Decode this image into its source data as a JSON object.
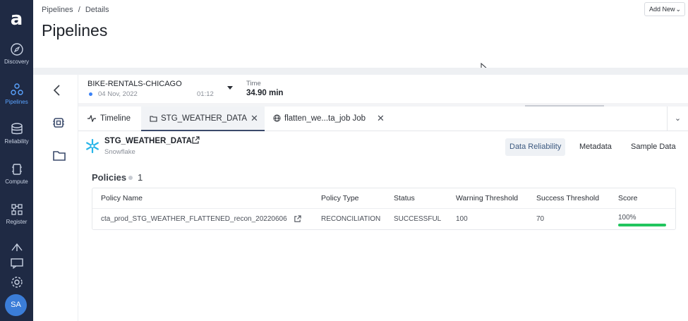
{
  "sidebar": {
    "logo": "a",
    "items": [
      {
        "label": "Discovery",
        "icon": "compass-icon",
        "active": false
      },
      {
        "label": "Pipelines",
        "icon": "pipelines-icon",
        "active": true
      },
      {
        "label": "Reliability",
        "icon": "database-icon",
        "active": false
      },
      {
        "label": "Compute",
        "icon": "chip-icon",
        "active": false
      },
      {
        "label": "Register",
        "icon": "register-icon",
        "active": false
      }
    ],
    "bottom_icons": [
      "upload-cloud-icon",
      "chat-icon",
      "gear-icon"
    ],
    "avatar": "SA"
  },
  "breadcrumb": {
    "root": "Pipelines",
    "separator": "/",
    "current": "Details"
  },
  "page_title": "Pipelines",
  "add_new": {
    "label": "Add New"
  },
  "pipeline": {
    "name": "BIKE-RENTALS-CHICAGO",
    "date": "04 Nov, 2022",
    "time": "01:12",
    "time_label": "Time",
    "duration": "34.90 min"
  },
  "tabs": [
    {
      "label": "Timeline",
      "icon": "activity-icon",
      "closable": false,
      "active": false
    },
    {
      "label": "STG_WEATHER_DATA",
      "icon": "folder-icon",
      "closable": true,
      "active": true
    },
    {
      "label": "flatten_we...ta_job Job",
      "icon": "globe-icon",
      "closable": true,
      "active": false
    }
  ],
  "asset": {
    "name": "STG_WEATHER_DATA",
    "source": "Snowflake"
  },
  "views": [
    {
      "label": "Data Reliability",
      "active": true
    },
    {
      "label": "Metadata",
      "active": false
    },
    {
      "label": "Sample Data",
      "active": false
    }
  ],
  "policies": {
    "title": "Policies",
    "count": "1",
    "columns": [
      "Policy Name",
      "Policy Type",
      "Status",
      "Warning Threshold",
      "Success Threshold",
      "Score"
    ],
    "rows": [
      {
        "name": "cta_prod_STG_WEATHER_FLATTENED_recon_20220606",
        "type": "RECONCILIATION",
        "status": "SUCCESSFUL",
        "warning": "100",
        "success": "70",
        "score": "100%",
        "score_value": 1.0
      }
    ]
  },
  "colors": {
    "sidebar_bg": "#1f2a44",
    "accent": "#5aa3ff",
    "score_bar": "#22c55e",
    "snowflake": "#29b5e8"
  }
}
